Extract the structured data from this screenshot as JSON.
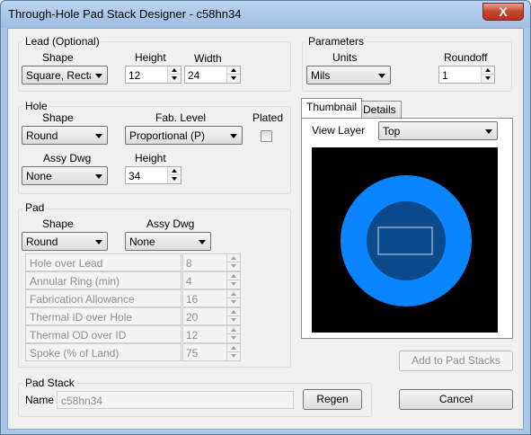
{
  "window": {
    "title": "Through-Hole Pad Stack Designer - c58hn34",
    "close_glyph": "X"
  },
  "lead": {
    "group_label": "Lead (Optional)",
    "shape_label": "Shape",
    "shape_value": "Square, Rectar",
    "height_label": "Height",
    "height_value": "12",
    "width_label": "Width",
    "width_value": "24"
  },
  "parameters": {
    "group_label": "Parameters",
    "units_label": "Units",
    "units_value": "Mils",
    "roundoff_label": "Roundoff",
    "roundoff_value": "1"
  },
  "hole": {
    "group_label": "Hole",
    "shape_label": "Shape",
    "shape_value": "Round",
    "fab_level_label": "Fab. Level",
    "fab_level_value": "Proportional (P)",
    "plated_label": "Plated",
    "plated_checked": false,
    "assy_dwg_label": "Assy Dwg",
    "assy_dwg_value": "None",
    "height_label": "Height",
    "height_value": "34"
  },
  "pad": {
    "group_label": "Pad",
    "shape_label": "Shape",
    "shape_value": "Round",
    "assy_dwg_label": "Assy Dwg",
    "assy_dwg_value": "None",
    "rows": [
      {
        "label": "Hole over Lead",
        "value": "8"
      },
      {
        "label": "Annular Ring (min)",
        "value": "4"
      },
      {
        "label": "Fabrication Allowance",
        "value": "16"
      },
      {
        "label": "Thermal ID over Hole",
        "value": "20"
      },
      {
        "label": "Thermal OD over ID",
        "value": "12"
      },
      {
        "label": "Spoke (% of Land)",
        "value": "75"
      }
    ]
  },
  "tabs": {
    "thumbnail": "Thumbnail",
    "details": "Details",
    "active": "thumbnail"
  },
  "thumbnail": {
    "view_layer_label": "View Layer",
    "view_layer_value": "Top",
    "colors": {
      "background": "#000000",
      "outer_ring": "#0a84ff",
      "inner_pad": "#0d4a8c",
      "hole_outline": "#c8d8f0"
    }
  },
  "pad_stack": {
    "group_label": "Pad Stack",
    "name_label": "Name",
    "name_value": "c58hn34"
  },
  "buttons": {
    "regen": "Regen",
    "add_to_pad_stacks": "Add to Pad Stacks",
    "cancel": "Cancel"
  }
}
